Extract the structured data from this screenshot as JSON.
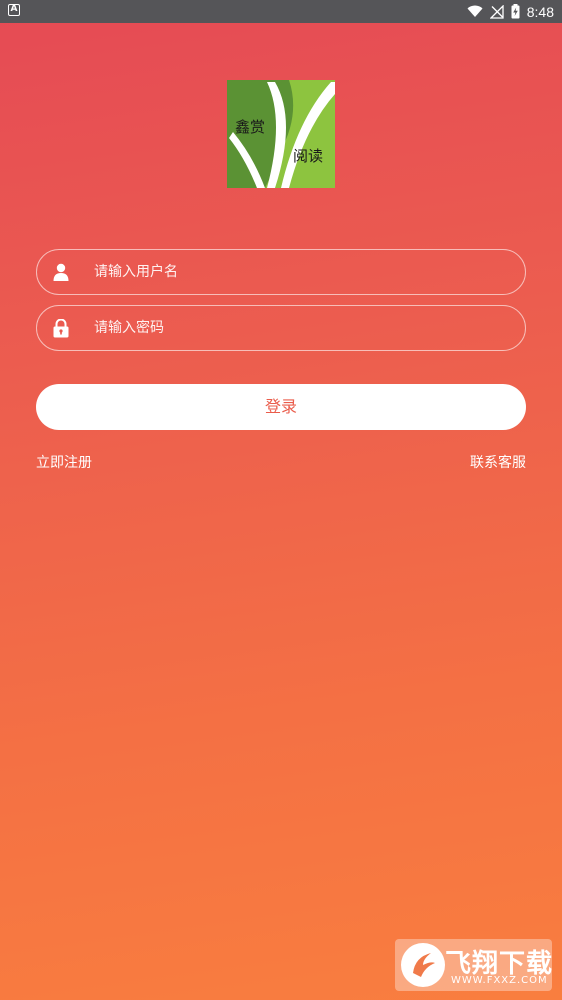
{
  "status_bar": {
    "left_icon": "A",
    "time": "8:48",
    "icons": [
      "wifi-icon",
      "signal-icon",
      "battery-charging-icon"
    ]
  },
  "logo": {
    "line1": "鑫赏",
    "line2": "阅读",
    "colors": {
      "dark_green": "#5b9234",
      "light_green": "#8dc43f",
      "stripe": "#ffffff"
    }
  },
  "form": {
    "username": {
      "placeholder": "请输入用户名",
      "icon": "user-icon"
    },
    "password": {
      "placeholder": "请输入密码",
      "icon": "lock-icon"
    },
    "login_label": "登录"
  },
  "links": {
    "register": "立即注册",
    "support": "联系客服"
  },
  "watermark": {
    "text": "飞翔下载",
    "url": "WWW.FXXZ.COM"
  },
  "colors": {
    "gradient_top": "#e54a55",
    "gradient_bottom": "#f97e3f",
    "login_text": "#ea5c4b",
    "status_bar": "#555558"
  }
}
